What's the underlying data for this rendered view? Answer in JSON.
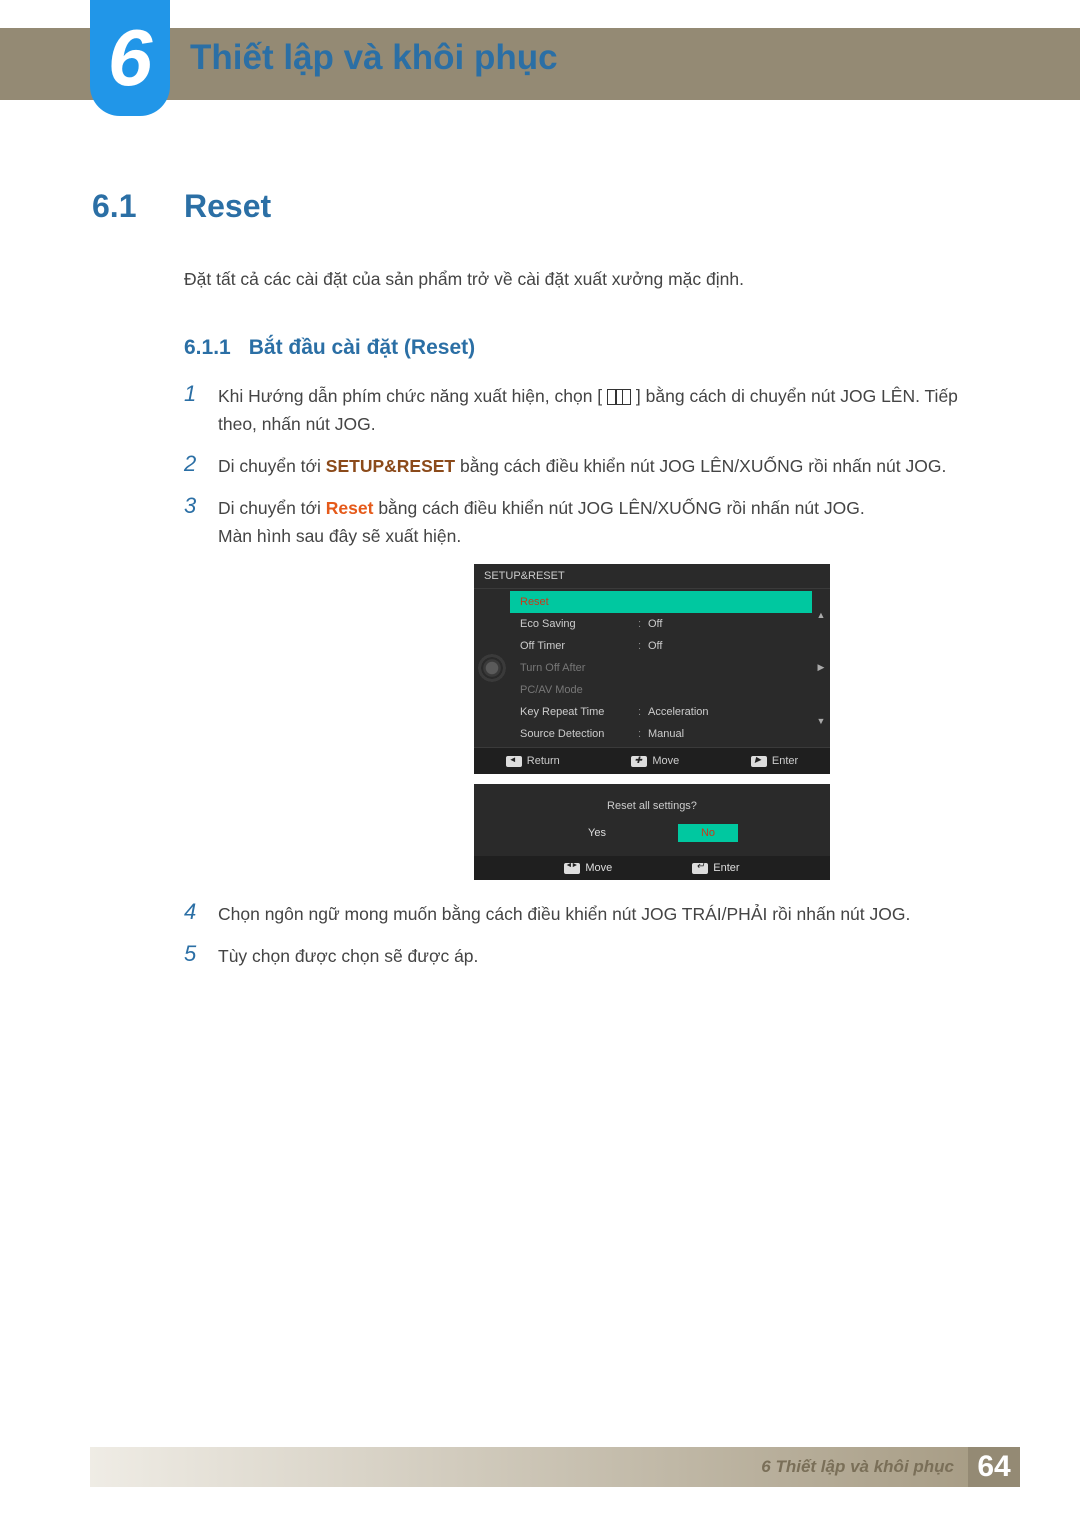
{
  "chapter": {
    "number": "6",
    "title": "Thiết lập và khôi phục"
  },
  "section": {
    "number": "6.1",
    "title": "Reset"
  },
  "intro": "Đặt tất cả các cài đặt của sản phẩm trở về cài đặt xuất xưởng mặc định.",
  "subsection": {
    "number": "6.1.1",
    "title": "Bắt đầu cài đặt (Reset)"
  },
  "steps": {
    "s1": {
      "num": "1",
      "a": "Khi Hướng dẫn phím chức năng xuất hiện, chọn [",
      "b": "] bằng cách di chuyển nút JOG LÊN. Tiếp theo, nhấn nút JOG."
    },
    "s2": {
      "num": "2",
      "a": "Di chuyển tới ",
      "bold": "SETUP&RESET",
      "b": " bằng cách điều khiển nút JOG LÊN/XUỐNG rồi nhấn nút JOG."
    },
    "s3": {
      "num": "3",
      "a": "Di chuyển tới ",
      "bold": "Reset",
      "b": " bằng cách điều khiển nút JOG LÊN/XUỐNG rồi nhấn nút JOG.",
      "c": "Màn hình sau đây sẽ xuất hiện."
    },
    "s4": {
      "num": "4",
      "text": "Chọn ngôn ngữ mong muốn bằng cách điều khiển nút JOG TRÁI/PHẢI rồi nhấn nút JOG."
    },
    "s5": {
      "num": "5",
      "text": "Tùy chọn được chọn sẽ được áp."
    }
  },
  "osd": {
    "header": "SETUP&RESET",
    "items": {
      "reset": "Reset",
      "eco": "Eco Saving",
      "eco_v": "Off",
      "offt": "Off Timer",
      "offt_v": "Off",
      "toa": "Turn Off After",
      "pcav": "PC/AV Mode",
      "krt": "Key Repeat Time",
      "krt_v": "Acceleration",
      "srcd": "Source Detection",
      "srcd_v": "Manual"
    },
    "footer": {
      "return": "Return",
      "move": "Move",
      "enter": "Enter"
    }
  },
  "osd2": {
    "question": "Reset all settings?",
    "yes": "Yes",
    "no": "No",
    "footer": {
      "move": "Move",
      "enter": "Enter"
    }
  },
  "footer": {
    "chapter_label": "6 Thiết lập và khôi phục",
    "page": "64"
  }
}
